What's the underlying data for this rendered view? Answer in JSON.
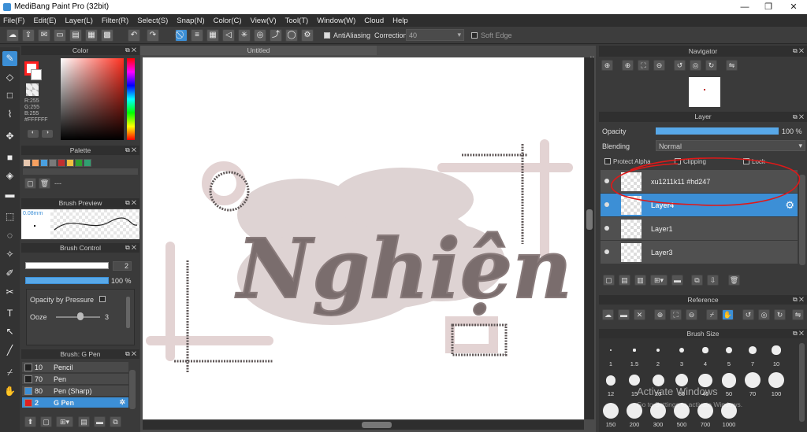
{
  "window": {
    "title": "MediBang Paint Pro (32bit)"
  },
  "menu": [
    "File(F)",
    "Edit(E)",
    "Layer(L)",
    "Filter(R)",
    "Select(S)",
    "Snap(N)",
    "Color(C)",
    "View(V)",
    "Tool(T)",
    "Window(W)",
    "Cloud",
    "Help"
  ],
  "toolbar": {
    "antialiasing_label": "AntiAliasing",
    "correction_label": "Correction",
    "correction_value": "40",
    "soft_edge_label": "Soft Edge"
  },
  "color_panel": {
    "title": "Color",
    "r": "R:255",
    "g": "G:255",
    "b": "B:255",
    "hex": "#FFFFFF",
    "fg": "#ff2020"
  },
  "palette_panel": {
    "title": "Palette",
    "colors": [
      "#e8c8b0",
      "#f5a060",
      "#4aa0e0",
      "#7a7a7a",
      "#c03030",
      "#f0c040",
      "#30a030",
      "#30a070"
    ],
    "dash": "---"
  },
  "brush_preview": {
    "title": "Brush Preview",
    "size": "0.08mm"
  },
  "brush_control": {
    "title": "Brush Control",
    "size_value": "2",
    "opacity_value": "100 %",
    "opacity_pressure_label": "Opacity by Pressure",
    "ooze_label": "Ooze",
    "ooze_value": "3"
  },
  "brush_list": {
    "title": "Brush: G Pen",
    "items": [
      {
        "num": "10",
        "label": "Pencil",
        "color": "#222"
      },
      {
        "num": "70",
        "label": "Pen",
        "color": "#222"
      },
      {
        "num": "80",
        "label": "Pen (Sharp)",
        "color": "#3c8fd6"
      },
      {
        "num": "2",
        "label": "G Pen",
        "color": "#e02020"
      }
    ]
  },
  "canvas": {
    "tab": "Untitled",
    "word": "Nghiện"
  },
  "navigator": {
    "title": "Navigator"
  },
  "layer_panel": {
    "title": "Layer",
    "opacity_label": "Opacity",
    "opacity_value": "100 %",
    "blending_label": "Blending",
    "blending_value": "Normal",
    "protect_alpha": "Protect Alpha",
    "clipping": "Clipping",
    "lock": "Lock",
    "layers": [
      {
        "name": "xu1211k11 #hd247"
      },
      {
        "name": "Layer4"
      },
      {
        "name": "Layer1"
      },
      {
        "name": "Layer3"
      }
    ]
  },
  "reference": {
    "title": "Reference"
  },
  "brush_size": {
    "title": "Brush Size",
    "sizes": [
      "1",
      "1.5",
      "2",
      "3",
      "4",
      "5",
      "7",
      "10",
      "12",
      "15",
      "20",
      "30",
      "40",
      "50",
      "70",
      "100",
      "150",
      "200",
      "300",
      "500",
      "700",
      "1000"
    ]
  },
  "watermark": {
    "line1": "Activate Windows",
    "line2": "Go to Settings to activate Windows."
  }
}
